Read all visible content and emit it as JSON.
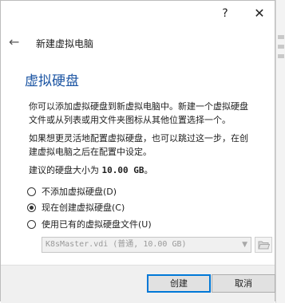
{
  "window": {
    "help_glyph": "?",
    "close_glyph": "✕"
  },
  "nav": {
    "back_glyph": "←",
    "title": "新建虚拟电脑"
  },
  "page": {
    "heading": "虚拟硬盘",
    "paragraph1_line1": "你可以添加虚拟硬盘到新虚拟电脑中。新建一个虚拟硬盘",
    "paragraph1_line2": "文件或从列表或用文件夹图标从其他位置选择一个。",
    "paragraph2_line1": "如果想更灵活地配置虚拟硬盘，也可以跳过这一步，在创",
    "paragraph2_line2": "建虚拟电脑之后在配置中设定。",
    "recommend_prefix": "建议的硬盘大小为",
    "recommend_size": "10.00 GB",
    "recommend_suffix": "。"
  },
  "options": [
    {
      "label": "不添加虚拟硬盘(D)",
      "checked": false
    },
    {
      "label": "现在创建虚拟硬盘(C)",
      "checked": true
    },
    {
      "label": "使用已有的虚拟硬盘文件(U)",
      "checked": false
    }
  ],
  "existing_disk": {
    "selected": "K8sMaster.vdi (普通, 10.00 GB)",
    "arrow_glyph": "▼",
    "folder_icon": "folder-open-icon"
  },
  "buttons": {
    "create": "创建",
    "cancel": "取消"
  },
  "colors": {
    "heading": "#1c55a3",
    "primary_border": "#0078d7",
    "footer_bg": "#f0f0f0",
    "folder": "#e8b84a"
  }
}
